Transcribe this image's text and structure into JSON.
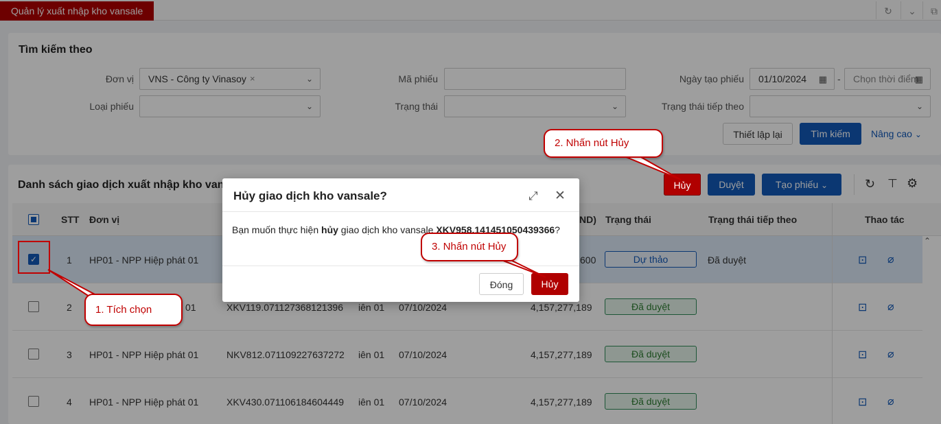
{
  "app": {
    "tab_title": "Quản lý xuất nhập kho vansale"
  },
  "search": {
    "title": "Tìm kiếm theo",
    "don_vi_label": "Đơn vị",
    "don_vi_value": "VNS - Công ty Vinasoy",
    "ma_phieu_label": "Mã phiếu",
    "ma_phieu_value": "",
    "ngay_tao_label": "Ngày tạo phiếu",
    "ngay_tao_from": "01/10/2024",
    "ngay_tao_dash": "-",
    "ngay_tao_to_placeholder": "Chọn thời điểm",
    "loai_phieu_label": "Loại phiếu",
    "trang_thai_label": "Trạng thái",
    "trang_thai_tiep_label": "Trạng thái tiếp theo",
    "reset_button": "Thiết lập lại",
    "search_button": "Tìm kiếm",
    "advanced_link": "Nâng cao"
  },
  "list": {
    "title": "Danh sách giao dịch xuất nhập kho van",
    "cancel_button": "Hủy",
    "approve_button": "Duyệt",
    "create_button": "Tạo phiếu",
    "columns": {
      "stt": "STT",
      "don_vi": "Đơn vị",
      "amount_tail": "ND)",
      "trang_thai": "Trạng thái",
      "trang_thai_tiep": "Trạng thái tiếp theo",
      "thao_tac": "Thao tác"
    },
    "rows": [
      {
        "stt": "1",
        "don_vi": "HP01 - NPP Hiệp phát 01",
        "ma": "",
        "nv": "",
        "ngay": "",
        "amount": "600",
        "trang_thai": "Dự thảo",
        "tiep_theo": "Đã duyệt"
      },
      {
        "stt": "2",
        "don_vi": "01",
        "ma": "XKV119.071127368121396",
        "nv": "iên 01",
        "ngay": "07/10/2024",
        "amount": "4,157,277,189",
        "trang_thai": "Đã duyệt",
        "tiep_theo": ""
      },
      {
        "stt": "3",
        "don_vi": "HP01 - NPP Hiệp phát 01",
        "ma": "NKV812.071109227637272",
        "nv": "iên 01",
        "ngay": "07/10/2024",
        "amount": "4,157,277,189",
        "trang_thai": "Đã duyệt",
        "tiep_theo": ""
      },
      {
        "stt": "4",
        "don_vi": "HP01 - NPP Hiệp phát 01",
        "ma": "XKV430.071106184604449",
        "nv": "iên 01",
        "ngay": "07/10/2024",
        "amount": "4,157,277,189",
        "trang_thai": "Đã duyệt",
        "tiep_theo": ""
      }
    ]
  },
  "modal": {
    "title": "Hủy giao dịch kho vansale?",
    "body_prefix": "Bạn muốn thực hiện ",
    "body_bold": "hủy",
    "body_middle": " giao dịch kho vansale ",
    "body_code": "XKV958.141451050439366",
    "body_suffix": "?",
    "close_button": "Đóng",
    "confirm_button": "Hủy"
  },
  "callouts": {
    "step1": "1. Tích chọn",
    "step2": "2. Nhấn nút Hủy",
    "step3": "3. Nhấn nút Hủy"
  },
  "colors": {
    "brand_red": "#b00000",
    "primary_blue": "#1259b8",
    "annotation_red": "#c00000"
  }
}
